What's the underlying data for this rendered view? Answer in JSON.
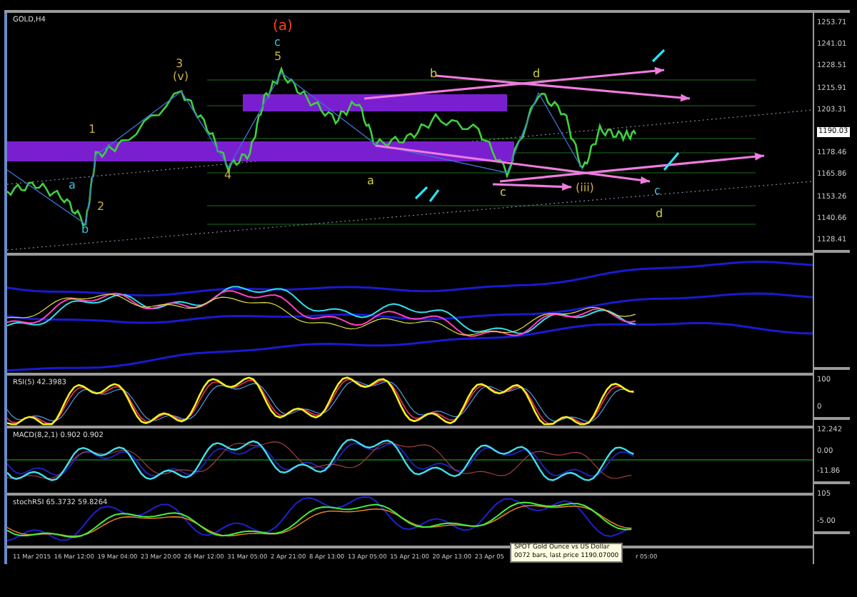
{
  "chart": {
    "symbol": "GOLD,H4",
    "wave_labels": [
      {
        "text": "(a)",
        "color": "#ff3b1f"
      },
      {
        "text": "c",
        "color": "#39c6e8"
      },
      {
        "text": "5",
        "color": "#c8b040"
      },
      {
        "text": "3",
        "color": "#c8b040"
      },
      {
        "text": "(v)",
        "color": "#c8b040"
      },
      {
        "text": "1",
        "color": "#c8b040"
      },
      {
        "text": "2",
        "color": "#c8b040"
      },
      {
        "text": "4",
        "color": "#c8b040"
      },
      {
        "text": "a",
        "color": "#39c6e8"
      },
      {
        "text": "b",
        "color": "#39c6e8"
      },
      {
        "text": "a",
        "color": "#d0d040"
      },
      {
        "text": "b",
        "color": "#d0d040"
      },
      {
        "text": "c",
        "color": "#d0d040"
      },
      {
        "text": "d",
        "color": "#d0d040"
      },
      {
        "text": "c",
        "color": "#39c6e8"
      },
      {
        "text": "d",
        "color": "#d0d040"
      },
      {
        "text": "(iii)",
        "color": "#c8b040"
      }
    ],
    "price_scale": [
      {
        "text": "1253.71",
        "kind": "tick"
      },
      {
        "text": "1241.01",
        "kind": "tick"
      },
      {
        "text": "1228.51",
        "kind": "tick"
      },
      {
        "text": "1215.91",
        "kind": "tick"
      },
      {
        "text": "1203.31",
        "kind": "tick"
      },
      {
        "text": "1190.03",
        "kind": "current"
      },
      {
        "text": "1178.46",
        "kind": "tick"
      },
      {
        "text": "1165.86",
        "kind": "tick"
      },
      {
        "text": "1153.26",
        "kind": "tick"
      },
      {
        "text": "1140.66",
        "kind": "tick"
      },
      {
        "text": "1128.41",
        "kind": "tick"
      }
    ]
  },
  "indicators": [
    {
      "kind": "bands"
    },
    {
      "kind": "rsi",
      "label": "RSI(5) 42.3983",
      "scale": [
        "100",
        "0"
      ]
    },
    {
      "kind": "macd",
      "label": "MACD(8,2,1) 0.902 0.902",
      "scale": [
        "12.242",
        "0.00",
        "-11.86"
      ]
    },
    {
      "kind": "stoch",
      "label": "stochRSI 65.3732 59.8264",
      "scale": [
        "105",
        "-5.00"
      ]
    }
  ],
  "time_axis": [
    "11 Mar 2015",
    "16 Mar 12:00",
    "19 Mar 04:00",
    "23 Mar 20:00",
    "26 Mar 12:00",
    "31 Mar 05:00",
    "2 Apr 21:00",
    "8 Apr 13:00",
    "13 Apr 05:00",
    "15 Apr 21:00",
    "20 Apr 13:00",
    "23 Apr 05",
    "r 05:00"
  ],
  "tooltip": {
    "lines": [
      "SPOT Gold Ounce vs US Dollar",
      "0072 bars, last price 1190.07000"
    ]
  }
}
